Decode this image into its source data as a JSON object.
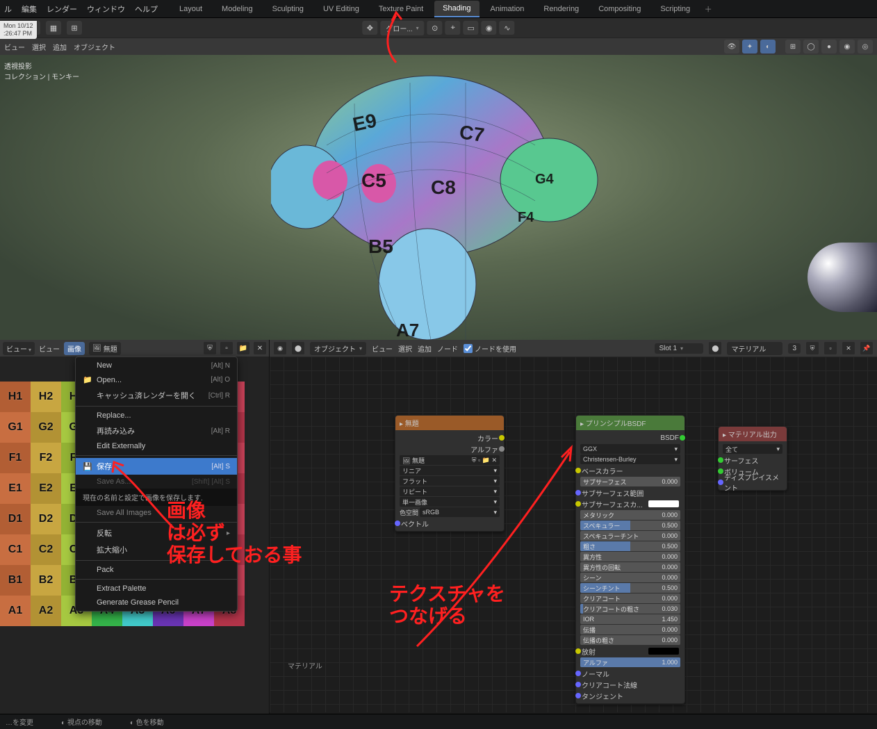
{
  "menubar": {
    "items": [
      "ル",
      "編集",
      "レンダー",
      "ウィンドウ",
      "ヘルプ"
    ]
  },
  "workspaces": {
    "tabs": [
      "Layout",
      "Modeling",
      "Sculpting",
      "UV Editing",
      "Texture Paint",
      "Shading",
      "Animation",
      "Rendering",
      "Compositing",
      "Scripting"
    ],
    "active": 5
  },
  "clock": {
    "line1": "Mon 10/12",
    "line2": ":26:47 PM"
  },
  "toolrow": {
    "mode": "グロー...",
    "left_icons": [
      "❏",
      "▦",
      "⊞"
    ]
  },
  "viewrow": {
    "items": [
      "ビュー",
      "選択",
      "追加",
      "オブジェクト"
    ]
  },
  "viewport_overlay": {
    "line1": "透視投影",
    "line2": "コレクション | モンキー"
  },
  "uv": {
    "leftdd": "ビュー",
    "view": "ビュー",
    "image": "画像",
    "image_field": "無題",
    "rows": [
      "H",
      "G",
      "F",
      "E",
      "D",
      "C",
      "B",
      "A"
    ]
  },
  "menu": {
    "new": {
      "label": "New",
      "sc": "[Alt] N"
    },
    "open": {
      "label": "Open...",
      "sc": "[Alt] O"
    },
    "cache": {
      "label": "キャッシュ済レンダーを開く",
      "sc": "[Ctrl] R"
    },
    "replace": {
      "label": "Replace...",
      "sc": ""
    },
    "reload": {
      "label": "再読み込み",
      "sc": "[Alt] R"
    },
    "editext": {
      "label": "Edit Externally",
      "sc": ""
    },
    "save": {
      "label": "保存",
      "sc": "[Alt] S"
    },
    "saveas": {
      "label": "Save As...",
      "sc": "[Shift] [Alt] S"
    },
    "tooltip": "現在の名前と設定で画像を保存します.",
    "saveall": {
      "label": "Save All Images",
      "sc": ""
    },
    "invert": {
      "label": "反転",
      "sc": ""
    },
    "scale": {
      "label": "拡大縮小",
      "sc": ""
    },
    "pack": {
      "label": "Pack",
      "sc": ""
    },
    "extract": {
      "label": "Extract Palette",
      "sc": ""
    },
    "grease": {
      "label": "Generate Grease Pencil",
      "sc": ""
    }
  },
  "nodehead": {
    "mode": "オブジェクト",
    "view": "ビュー",
    "select": "選択",
    "add": "追加",
    "node": "ノード",
    "use_nodes": "ノードを使用",
    "slot": "Slot 1",
    "mat": "マテリアル",
    "count": "3"
  },
  "imgnode": {
    "title": "▸ 無題",
    "out_color": "カラー",
    "out_alpha": "アルファ",
    "imgfield": "無題",
    "dd1": "リニア",
    "dd2": "フラット",
    "dd3": "リピート",
    "dd4": "単一画像",
    "cs_label": "色空間",
    "cs_val": "sRGB",
    "vec": "ベクトル"
  },
  "bsdf": {
    "title": "▸ プリンシプルBSDF",
    "out": "BSDF",
    "dist": "GGX",
    "sss": "Christensen-Burley",
    "base": "ベースカラー",
    "subs": {
      "l": "サブサーフェス",
      "v": "0.000"
    },
    "sradius": "サブサーフェス範囲",
    "scolor": "サブサーフェスカ...",
    "metal": {
      "l": "メタリック",
      "v": "0.000"
    },
    "spec": {
      "l": "スペキュラー",
      "v": "0.500"
    },
    "spectint": {
      "l": "スペキュラーチント",
      "v": "0.000"
    },
    "rough": {
      "l": "粗さ",
      "v": "0.500"
    },
    "aniso": {
      "l": "異方性",
      "v": "0.000"
    },
    "anisorot": {
      "l": "異方性の回転",
      "v": "0.000"
    },
    "sheen": {
      "l": "シーン",
      "v": "0.000"
    },
    "sheentint": {
      "l": "シーンチント",
      "v": "0.500"
    },
    "cc": {
      "l": "クリアコート",
      "v": "0.000"
    },
    "ccrough": {
      "l": "クリアコートの粗さ",
      "v": "0.030"
    },
    "ior": {
      "l": "IOR",
      "v": "1.450"
    },
    "trans": {
      "l": "伝播",
      "v": "0.000"
    },
    "transrough": {
      "l": "伝播の粗さ",
      "v": "0.000"
    },
    "emit": "放射",
    "alpha": {
      "l": "アルファ",
      "v": "1.000"
    },
    "normal": "ノーマル",
    "ccnorm": "クリアコート法線",
    "tangent": "タンジェント"
  },
  "output": {
    "title": "▸ マテリアル出力",
    "dd": "全て",
    "surf": "サーフェス",
    "vol": "ボリューム",
    "disp": "ディスプレイスメント"
  },
  "matlabel": "マテリアル",
  "annotation": {
    "text1": "画像\nは必ず\n保存しておる事",
    "text2": "テクスチャを\nつなげる"
  },
  "footer": {
    "left": "…を変更",
    "mid": "視点の移動",
    "right": "色を移動"
  }
}
